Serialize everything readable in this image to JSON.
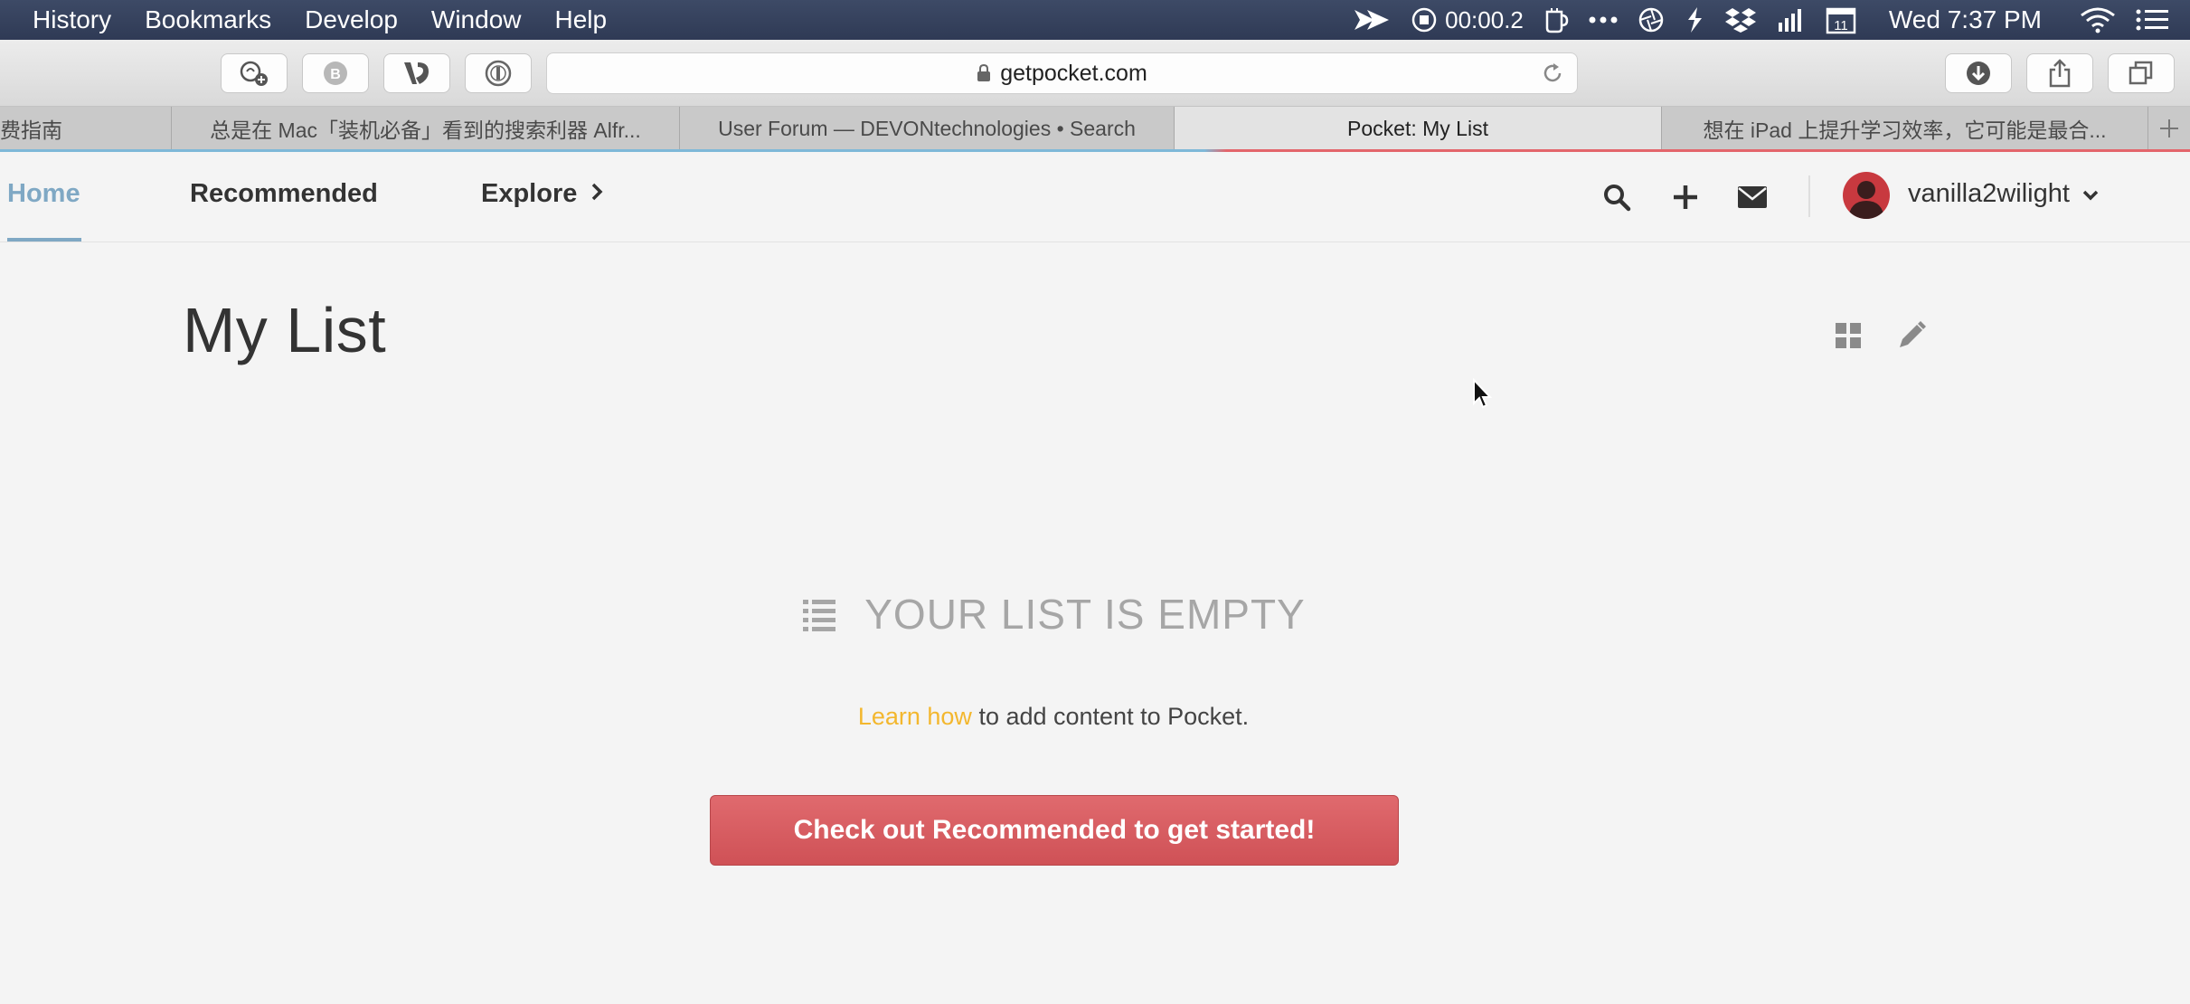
{
  "menubar": {
    "menus": [
      "History",
      "Bookmarks",
      "Develop",
      "Window",
      "Help"
    ],
    "recording_time": "00:00.2",
    "calendar_day": "11",
    "clock": "Wed 7:37 PM"
  },
  "toolbar": {
    "url": "getpocket.com",
    "extensions": [
      "pocket-add",
      "B",
      "V",
      "1password"
    ]
  },
  "tabs": [
    {
      "label": "费指南",
      "active": false
    },
    {
      "label": "总是在 Mac「装机必备」看到的搜索利器 Alfr...",
      "active": false
    },
    {
      "label": "User Forum — DEVONtechnologies • Search",
      "active": false
    },
    {
      "label": "Pocket: My List",
      "active": true
    },
    {
      "label": "想在 iPad 上提升学习效率，它可能是最合...",
      "active": false
    }
  ],
  "pocket_nav": {
    "home": "Home",
    "recommended": "Recommended",
    "explore": "Explore",
    "username": "vanilla2wilight"
  },
  "main": {
    "title": "My List",
    "empty_title": "YOUR LIST IS EMPTY",
    "learn_link": "Learn how",
    "empty_text": " to add content to Pocket.",
    "cta": "Check out Recommended to get started!"
  },
  "colors": {
    "home_active": "#7fa8c4",
    "cta": "#d65a5f",
    "learn_link": "#f3b72e",
    "menubar": "#34405c"
  }
}
